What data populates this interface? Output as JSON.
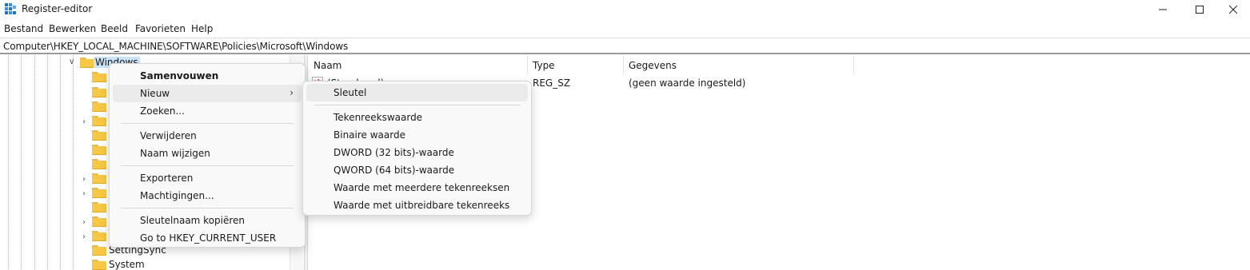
{
  "window": {
    "title": "Register-editor"
  },
  "menubar": {
    "items": [
      "Bestand",
      "Bewerken",
      "Beeld",
      "Favorieten",
      "Help"
    ]
  },
  "address": {
    "path": "Computer\\HKEY_LOCAL_MACHINE\\SOFTWARE\\Policies\\Microsoft\\Windows"
  },
  "tree": {
    "selected": "Windows",
    "visible_labels": [
      "SettingSync",
      "System"
    ]
  },
  "list": {
    "columns": [
      "Naam",
      "Type",
      "Gegevens"
    ],
    "rows": [
      {
        "name": "(Standaard)",
        "type": "REG_SZ",
        "data": "(geen waarde ingesteld)"
      }
    ]
  },
  "context_menu": {
    "items": [
      {
        "label": "Samenvouwen"
      },
      {
        "label": "Nieuw"
      },
      {
        "label": "Zoeken..."
      },
      {
        "label": "Verwijderen"
      },
      {
        "label": "Naam wijzigen"
      },
      {
        "label": "Exporteren"
      },
      {
        "label": "Machtigingen..."
      },
      {
        "label": "Sleutelnaam kopiëren"
      },
      {
        "label": "Go to HKEY_CURRENT_USER"
      }
    ]
  },
  "submenu": {
    "items": [
      {
        "label": "Sleutel"
      },
      {
        "label": "Tekenreekswaarde"
      },
      {
        "label": "Binaire waarde"
      },
      {
        "label": "DWORD (32 bits)-waarde"
      },
      {
        "label": "QWORD (64 bits)-waarde"
      },
      {
        "label": "Waarde met meerdere tekenreeksen"
      },
      {
        "label": "Waarde met uitbreidbare tekenreeks"
      }
    ]
  }
}
